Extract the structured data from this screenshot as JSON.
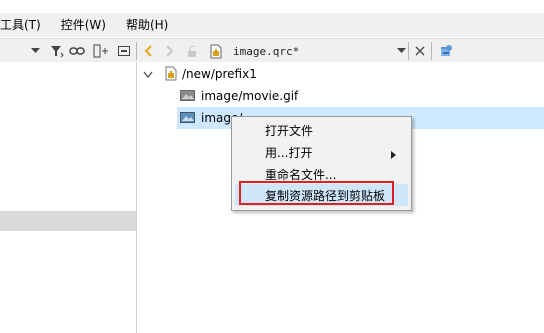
{
  "menubar": {
    "items": [
      {
        "label": "工具(T)"
      },
      {
        "label": "控件(W)"
      },
      {
        "label": "帮助(H)"
      }
    ]
  },
  "toolbar": {
    "file_combo": "image.qrc*"
  },
  "tree": {
    "prefix": "/new/prefix1",
    "items": [
      {
        "label": "image/movie.gif"
      },
      {
        "label": "image/"
      }
    ]
  },
  "context_menu": {
    "items": [
      {
        "label": "打开文件"
      },
      {
        "label": "用...打开"
      },
      {
        "label": "重命名文件..."
      },
      {
        "label": "复制资源路径到剪贴板"
      }
    ]
  },
  "colors": {
    "selection": "#cde8ff",
    "highlight_border": "#e02020"
  }
}
